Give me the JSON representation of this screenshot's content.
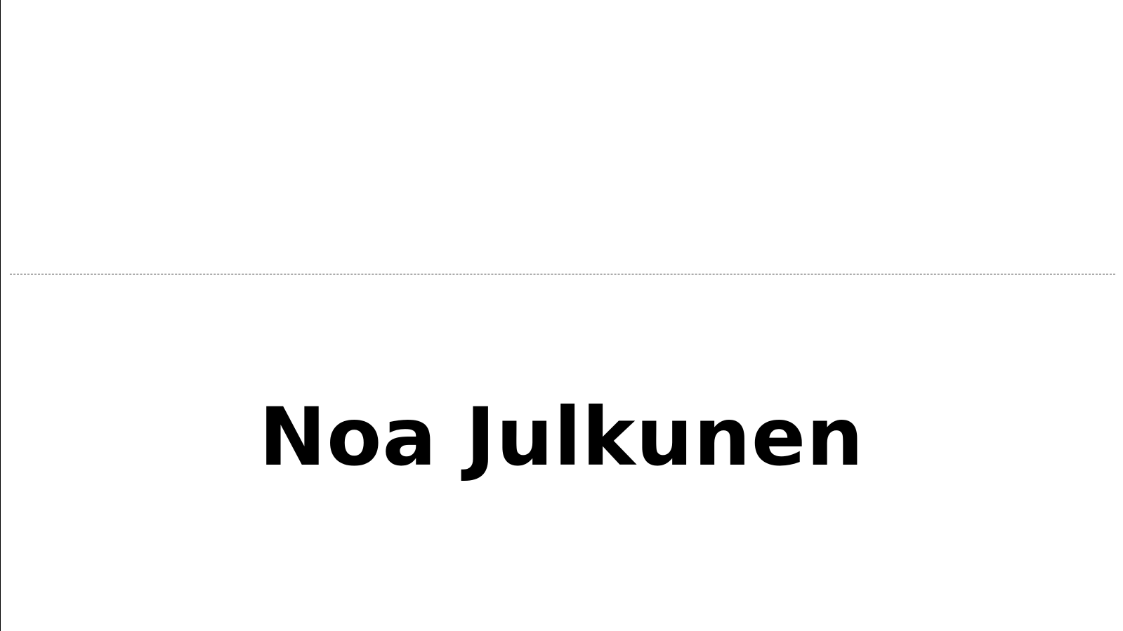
{
  "card": {
    "name": "Noa Julkunen"
  },
  "colors": {
    "background": "#ffffff",
    "text": "#000000",
    "fold_line": "#333333"
  }
}
